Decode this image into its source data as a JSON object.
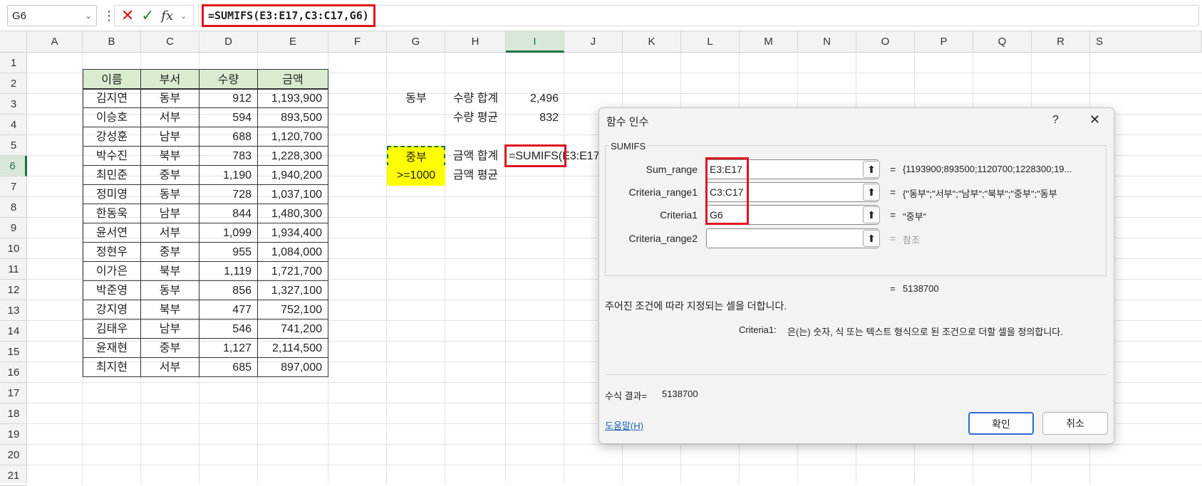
{
  "name_box": "G6",
  "formula": "=SUMIFS(E3:E17,C3:C17,G6)",
  "columns": [
    "A",
    "B",
    "C",
    "D",
    "E",
    "F",
    "G",
    "H",
    "I",
    "J",
    "K",
    "L",
    "M",
    "N",
    "O",
    "P",
    "Q",
    "R",
    "S"
  ],
  "rows": [
    "1",
    "2",
    "3",
    "4",
    "5",
    "6",
    "7",
    "8",
    "9",
    "10",
    "11",
    "12",
    "13",
    "14",
    "15",
    "16",
    "17",
    "18",
    "19",
    "20",
    "21"
  ],
  "table": {
    "headers": [
      "이름",
      "부서",
      "수량",
      "금액"
    ],
    "rows": [
      [
        "김지연",
        "동부",
        "912",
        "1,193,900"
      ],
      [
        "이승호",
        "서부",
        "594",
        "893,500"
      ],
      [
        "강성훈",
        "남부",
        "688",
        "1,120,700"
      ],
      [
        "박수진",
        "북부",
        "783",
        "1,228,300"
      ],
      [
        "최민준",
        "중부",
        "1,190",
        "1,940,200"
      ],
      [
        "정미영",
        "동부",
        "728",
        "1,037,100"
      ],
      [
        "한동욱",
        "남부",
        "844",
        "1,480,300"
      ],
      [
        "윤서연",
        "서부",
        "1,099",
        "1,934,400"
      ],
      [
        "정현우",
        "중부",
        "955",
        "1,084,000"
      ],
      [
        "이가은",
        "북부",
        "1,119",
        "1,721,700"
      ],
      [
        "박준영",
        "동부",
        "856",
        "1,327,100"
      ],
      [
        "강지영",
        "북부",
        "477",
        "752,100"
      ],
      [
        "김태우",
        "남부",
        "546",
        "741,200"
      ],
      [
        "윤재현",
        "중부",
        "1,127",
        "2,114,500"
      ],
      [
        "최지현",
        "서부",
        "685",
        "897,000"
      ]
    ]
  },
  "summary": {
    "g3": "동부",
    "h3": "수량 합계",
    "i3": "2,496",
    "h4": "수량 평균",
    "i4": "832",
    "g6": "중부",
    "h6": "금액 합계",
    "i6": "=SUMIFS(E3:E17,",
    "g7": ">=1000",
    "h7": "금액 평균"
  },
  "dialog": {
    "title": "함수 인수",
    "help_char": "?",
    "close_char": "✕",
    "function_name": "SUMIFS",
    "args": [
      {
        "label": "Sum_range",
        "value": "E3:E17",
        "result": "{1193900;893500;1120700;1228300;19..."
      },
      {
        "label": "Criteria_range1",
        "value": "C3:C17",
        "result": "{\"동부\";\"서부\";\"남부\";\"북부\";\"중부\";\"동부"
      },
      {
        "label": "Criteria1",
        "value": "G6",
        "result": "\"중부\""
      },
      {
        "label": "Criteria_range2",
        "value": "",
        "result": "참조"
      }
    ],
    "eq": "=",
    "total_result": "5138700",
    "description": "주어진 조건에 따라 지정되는 셀을 더합니다.",
    "arg_help_label": "Criteria1:",
    "arg_help_text": "은(는) 숫자, 식 또는 텍스트 형식으로 된 조건으로 더할 셀을 정의합니다.",
    "formula_result_label": "수식 결과=",
    "formula_result_value": "5138700",
    "help_link": "도움말(H)",
    "ok": "확인",
    "cancel": "취소"
  },
  "colors": {
    "accent_red": "#e0141e",
    "header_green": "#d9ecd0",
    "highlight_yellow": "#ffff00",
    "excel_green": "#1e7145"
  }
}
